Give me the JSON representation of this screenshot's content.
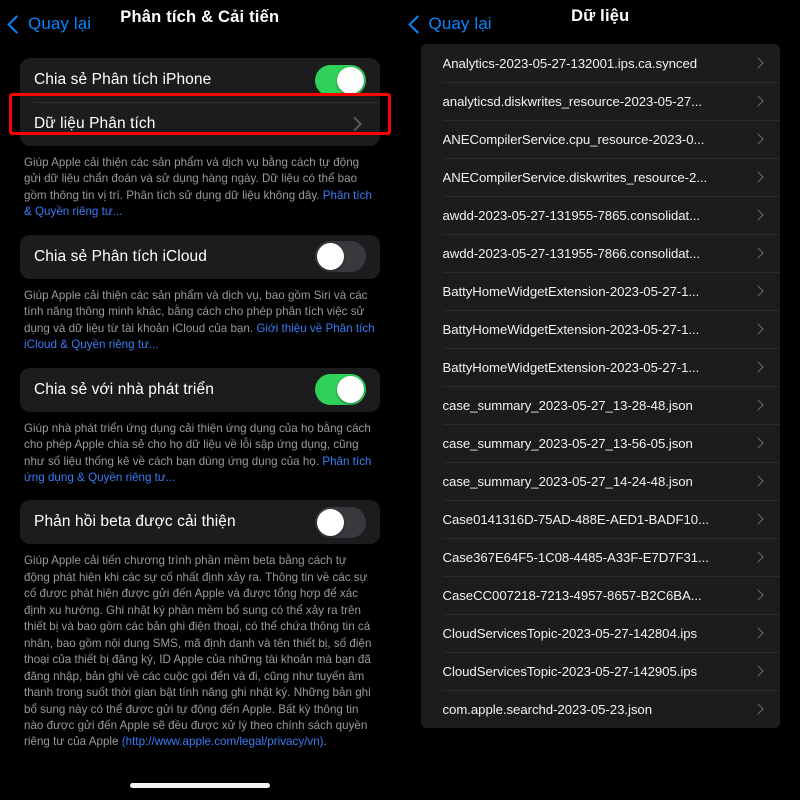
{
  "left": {
    "nav": {
      "back_label": "Quay lại",
      "title": "Phân tích & Cải tiến"
    },
    "groups": [
      {
        "rows": [
          {
            "label": "Chia sẻ Phân tích iPhone",
            "control": "toggle",
            "state": "on"
          },
          {
            "label": "Dữ liệu Phân tích",
            "control": "chevron",
            "highlighted": true
          }
        ],
        "desc_text": "Giúp Apple cải thiện các sản phẩm và dịch vụ bằng cách tự động gửi dữ liệu chẩn đoán và sử dụng hàng ngày. Dữ liệu có thể bao gồm thông tin vị trí. Phân tích sử dụng dữ liệu không dây. ",
        "desc_link": "Phân tích & Quyền riêng tư..."
      },
      {
        "rows": [
          {
            "label": "Chia sẻ Phân tích iCloud",
            "control": "toggle",
            "state": "off"
          }
        ],
        "desc_text": "Giúp Apple cải thiện các sản phẩm và dịch vụ, bao gồm Siri và các tính năng thông minh khác, bằng cách cho phép phân tích việc sử dụng và dữ liệu từ tài khoản iCloud của bạn. ",
        "desc_link": "Giới thiệu về Phân tích iCloud & Quyền riêng tư..."
      },
      {
        "rows": [
          {
            "label": "Chia sẻ với nhà phát triển",
            "control": "toggle",
            "state": "on"
          }
        ],
        "desc_text": "Giúp nhà phát triển ứng dụng cải thiện ứng dụng của họ bằng cách cho phép Apple chia sẻ cho họ dữ liệu về lỗi sập ứng dụng, cũng như số liệu thống kê về cách bạn dùng ứng dụng của họ. ",
        "desc_link": "Phân tích ứng dụng & Quyền riêng tư..."
      },
      {
        "rows": [
          {
            "label": "Phản hồi beta được cải thiện",
            "control": "toggle",
            "state": "off"
          }
        ],
        "desc_text": "Giúp Apple cải tiến chương trình phần mềm beta bằng cách tự động phát hiện khi các sự cố nhất định xảy ra. Thông tin về các sự cố được phát hiện được gửi đến Apple và được tổng hợp để xác định xu hướng. Ghi nhật ký phần mềm bổ sung có thể xảy ra trên thiết bị và bao gồm các bản ghi điện thoại, có thể chứa thông tin cá nhân, bao gồm nội dung SMS, mã định danh và tên thiết bị, số điện thoại của thiết bị đăng ký, ID Apple của những tài khoản mà bạn đã đăng nhập, bản ghi về các cuộc gọi đến và đi, cũng như tuyến âm thanh trong suốt thời gian bật tính năng ghi nhật ký. Những bản ghi bổ sung này có thể được gửi tự động đến Apple. Bất kỳ thông tin nào được gửi đến Apple sẽ đều được xử lý theo chính sách quyền riêng tư của Apple ",
        "desc_link": "(http://www.apple.com/legal/privacy/vn)",
        "desc_tail": "."
      }
    ]
  },
  "right": {
    "nav": {
      "back_label": "Quay lại",
      "title": "Dữ liệu"
    },
    "files": [
      {
        "name": "Analytics-2023-05-27-132001.ips.ca.synced",
        "highlighted": true
      },
      {
        "name": "analyticsd.diskwrites_resource-2023-05-27..."
      },
      {
        "name": "ANECompilerService.cpu_resource-2023-0..."
      },
      {
        "name": "ANECompilerService.diskwrites_resource-2..."
      },
      {
        "name": "awdd-2023-05-27-131955-7865.consolidat..."
      },
      {
        "name": "awdd-2023-05-27-131955-7866.consolidat..."
      },
      {
        "name": "BattyHomeWidgetExtension-2023-05-27-1..."
      },
      {
        "name": "BattyHomeWidgetExtension-2023-05-27-1..."
      },
      {
        "name": "BattyHomeWidgetExtension-2023-05-27-1..."
      },
      {
        "name": "case_summary_2023-05-27_13-28-48.json"
      },
      {
        "name": "case_summary_2023-05-27_13-56-05.json"
      },
      {
        "name": "case_summary_2023-05-27_14-24-48.json"
      },
      {
        "name": "Case0141316D-75AD-488E-AED1-BADF10..."
      },
      {
        "name": "Case367E64F5-1C08-4485-A33F-E7D7F31..."
      },
      {
        "name": "CaseCC007218-7213-4957-8657-B2C6BA..."
      },
      {
        "name": "CloudServicesTopic-2023-05-27-142804.ips"
      },
      {
        "name": "CloudServicesTopic-2023-05-27-142905.ips"
      },
      {
        "name": "com.apple.searchd-2023-05-23.json"
      }
    ]
  },
  "colors": {
    "accent_blue": "#0a84ff",
    "toggle_on": "#30d158",
    "toggle_off": "#39393d",
    "highlight_red": "#ff0000",
    "card_bg": "#1c1c1e"
  }
}
